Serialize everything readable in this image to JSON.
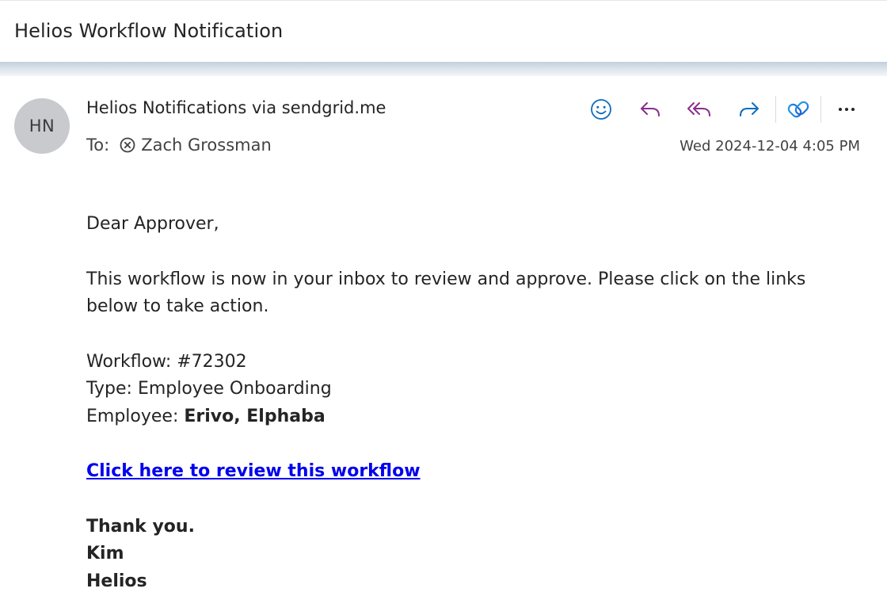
{
  "subject": "Helios Workflow Notification",
  "sender": {
    "initials": "HN",
    "name": "Helios Notifications via sendgrid.me"
  },
  "recipients": {
    "label": "To:",
    "name": "Zach Grossman"
  },
  "date": "Wed 2024-12-04 4:05 PM",
  "toolbar": {
    "icons": [
      "emoji-icon",
      "reply-icon",
      "reply-all-icon",
      "forward-icon",
      "copilot-icon",
      "more-icon"
    ],
    "colors": {
      "emoji": "#0f6cbd",
      "reply": "#8a2e8c",
      "forward": "#0f6cbd"
    }
  },
  "body": {
    "greeting": "Dear Approver,",
    "intro": "This workflow is now in your inbox to review and approve. Please click on the links below to take action.",
    "workflow_label": "Workflow: ",
    "workflow_value": "#72302",
    "type_label": "Type: ",
    "type_value": "Employee Onboarding",
    "employee_label": "Employee: ",
    "employee_value": "Erivo, Elphaba",
    "link_text": "Click here to review this workflow",
    "closing": "Thank you.",
    "signature_name": "Kim",
    "signature_org": "Helios"
  }
}
